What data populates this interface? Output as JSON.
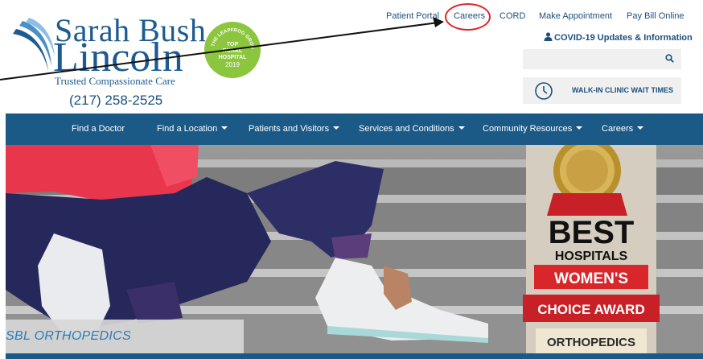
{
  "logo": {
    "name_line1": "Sarah Bush",
    "name_line2": "Lincoln",
    "tagline": "Trusted Compassionate Care",
    "phone": "(217) 258-2525",
    "brand_color": "#1c5a90"
  },
  "badge": {
    "arc_text": "THE LEAPFROG GROUP",
    "line1": "TOP",
    "line2": "RURAL",
    "line3": "HOSPITAL",
    "year": "2019",
    "color": "#8cc63f"
  },
  "utility_nav": {
    "patient_portal": "Patient Portal",
    "careers": "Careers",
    "cord": "CORD",
    "make_appointment": "Make Appointment",
    "pay_bill": "Pay Bill Online"
  },
  "covid": {
    "icon": "user-icon",
    "label": "COVID-19 Updates & Information"
  },
  "search": {
    "value": "",
    "placeholder": "",
    "icon": "search-icon"
  },
  "walkin": {
    "icon": "clock-icon",
    "label": "WALK-IN CLINIC WAIT TIMES"
  },
  "main_nav": {
    "items": [
      {
        "label": "Find a Doctor",
        "dropdown": false
      },
      {
        "label": "Find a Location",
        "dropdown": true
      },
      {
        "label": "Patients and Visitors",
        "dropdown": true
      },
      {
        "label": "Services and Conditions",
        "dropdown": true
      },
      {
        "label": "Community Resources",
        "dropdown": true
      },
      {
        "label": "Careers",
        "dropdown": true
      }
    ],
    "color": "#1b5a87"
  },
  "hero": {
    "banner_text": "SBL ORTHOPEDICS",
    "award": {
      "line1": "BEST",
      "line2": "HOSPITALS",
      "line3": "WOMEN'S",
      "line4": "CHOICE AWARD",
      "line5": "ORTHOPEDICS",
      "accent": "#d9262b"
    }
  },
  "annotation": {
    "highlight_color": "#d9262b"
  }
}
